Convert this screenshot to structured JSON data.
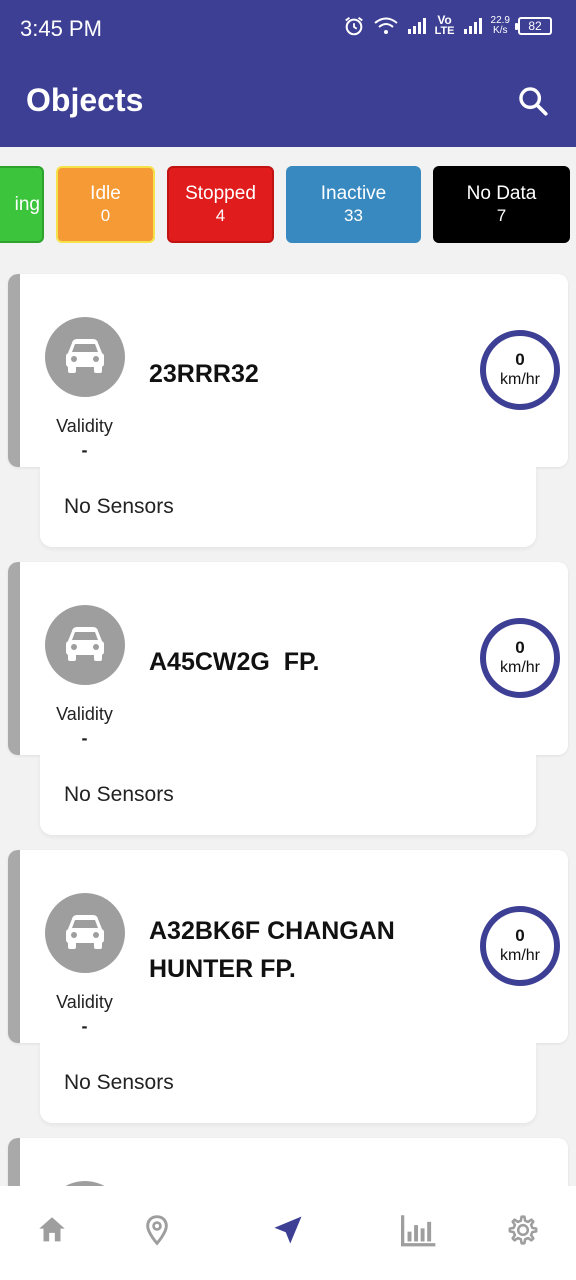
{
  "status_bar": {
    "time": "3:45 PM",
    "net_speed_value": "22.9",
    "net_speed_unit": "K/s",
    "battery": "82",
    "network_label_top": "Vo",
    "network_label_bottom": "LTE"
  },
  "header": {
    "title": "Objects",
    "search_icon": "search-icon"
  },
  "filters": [
    {
      "label": "ing",
      "count": "",
      "color": "#3cc43c"
    },
    {
      "label": "Idle",
      "count": "0",
      "color": "#f59a35"
    },
    {
      "label": "Stopped",
      "count": "4",
      "color": "#e01c1c"
    },
    {
      "label": "Inactive",
      "count": "33",
      "color": "#3889c0"
    },
    {
      "label": "No Data",
      "count": "7",
      "color": "#000000"
    }
  ],
  "objects": [
    {
      "name": "23RRR32",
      "validity_label": "Validity",
      "validity_value": "-",
      "speed": "0",
      "speed_unit": "km/hr",
      "sensors": "No Sensors"
    },
    {
      "name": "A45CW2G  FP.",
      "validity_label": "Validity",
      "validity_value": "-",
      "speed": "0",
      "speed_unit": "km/hr",
      "sensors": "No Sensors"
    },
    {
      "name_line1": "A32BK6F CHANGAN",
      "name_line2": "HUNTER FP.",
      "validity_label": "Validity",
      "validity_value": "-",
      "speed": "0",
      "speed_unit": "km/hr",
      "sensors": "No Sensors"
    }
  ],
  "bottom_nav": [
    {
      "icon": "home-icon",
      "active": false
    },
    {
      "icon": "location-pin-icon",
      "active": false
    },
    {
      "icon": "navigation-arrow-icon",
      "active": true
    },
    {
      "icon": "bar-chart-icon",
      "active": false
    },
    {
      "icon": "gear-icon",
      "active": false
    }
  ],
  "colors": {
    "primary": "#3d3f95",
    "inactive_icon": "#9e9e9e",
    "status_bar_gray": "#a9a9a9"
  }
}
